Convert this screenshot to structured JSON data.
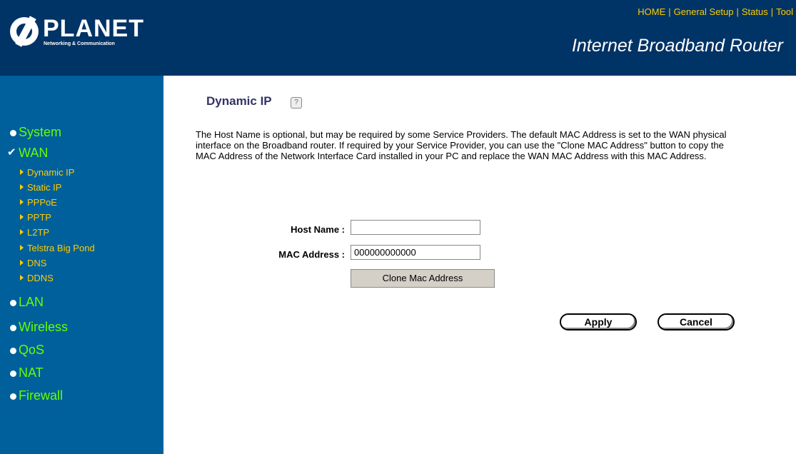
{
  "header": {
    "brand": "PLANET",
    "tagline": "Networking & Communication",
    "product": "Internet Broadband Router",
    "nav": [
      "HOME",
      "General Setup",
      "Status",
      "Tool"
    ],
    "colors": {
      "background": "#003366",
      "nav": "#ffcc00"
    }
  },
  "sidebar": {
    "items": [
      {
        "label": "System",
        "icon": "bullet-icon"
      },
      {
        "label": "WAN",
        "icon": "check-icon"
      },
      {
        "label": "LAN",
        "icon": "bullet-icon"
      },
      {
        "label": "Wireless",
        "icon": "bullet-icon"
      },
      {
        "label": "QoS",
        "icon": "bullet-icon"
      },
      {
        "label": "NAT",
        "icon": "bullet-icon"
      },
      {
        "label": "Firewall",
        "icon": "bullet-icon"
      }
    ],
    "wan_subitems": [
      "Dynamic IP",
      "Static IP",
      "PPPoE",
      "PPTP",
      "L2TP",
      "Telstra Big Pond",
      "DNS",
      "DDNS"
    ],
    "colors": {
      "background": "#00609b",
      "item": "#66ff00",
      "subitem": "#ffcc00"
    }
  },
  "main": {
    "title": "Dynamic IP",
    "description": "The Host Name is optional, but may be required by some Service Providers. The default MAC Address is set to the WAN physical interface on the Broadband router. If required by your Service Provider, you can use the \"Clone MAC Address\" button to copy the MAC Address of the Network Interface Card installed in your PC and replace the WAN MAC Address with this MAC Address.",
    "host_name_label": "Host Name :",
    "host_name_value": "",
    "mac_label": "MAC Address :",
    "mac_value": "000000000000",
    "clone_button": "Clone Mac Address",
    "apply_button": "Apply",
    "cancel_button": "Cancel"
  }
}
